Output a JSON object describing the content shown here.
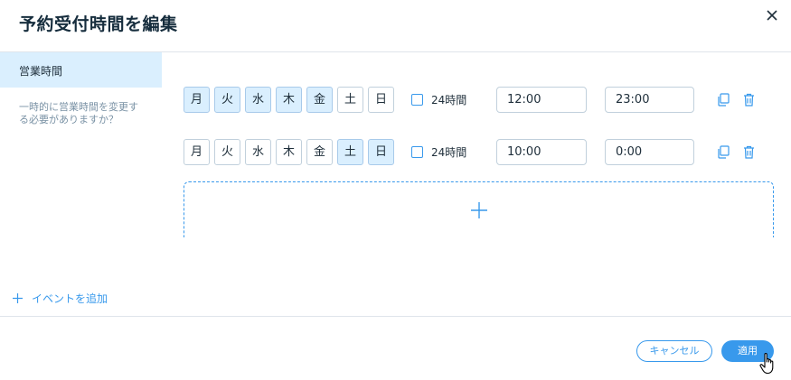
{
  "dialog": {
    "title": "予約受付時間を編集"
  },
  "sidebar": {
    "item_label": "営業時間",
    "note": "一時的に営業時間を変更する必要がありますか？"
  },
  "rows": [
    {
      "days": [
        {
          "label": "月",
          "selected": true
        },
        {
          "label": "火",
          "selected": true
        },
        {
          "label": "水",
          "selected": true
        },
        {
          "label": "木",
          "selected": true
        },
        {
          "label": "金",
          "selected": true
        },
        {
          "label": "土",
          "selected": false
        },
        {
          "label": "日",
          "selected": false
        }
      ],
      "all_day_label": "24時間",
      "all_day_checked": false,
      "start_time": "12:00",
      "end_time": "23:00"
    },
    {
      "days": [
        {
          "label": "月",
          "selected": false
        },
        {
          "label": "火",
          "selected": false
        },
        {
          "label": "水",
          "selected": false
        },
        {
          "label": "木",
          "selected": false
        },
        {
          "label": "金",
          "selected": false
        },
        {
          "label": "土",
          "selected": true
        },
        {
          "label": "日",
          "selected": true
        }
      ],
      "all_day_label": "24時間",
      "all_day_checked": false,
      "start_time": "10:00",
      "end_time": "0:00"
    }
  ],
  "add_event": {
    "label": "イベントを追加"
  },
  "footer": {
    "cancel_label": "キャンセル",
    "apply_label": "適用"
  },
  "icons": {
    "close": "close-icon",
    "duplicate": "duplicate-icon",
    "delete": "trash-icon",
    "add": "plus-icon",
    "cursor": "hand-pointer-icon"
  },
  "colors": {
    "accent": "#3899ec",
    "selected_day_bg": "#daeffe",
    "sidebar_active_bg": "#daeffe",
    "muted_text": "#7a92a5",
    "border": "#c1d0dc"
  }
}
